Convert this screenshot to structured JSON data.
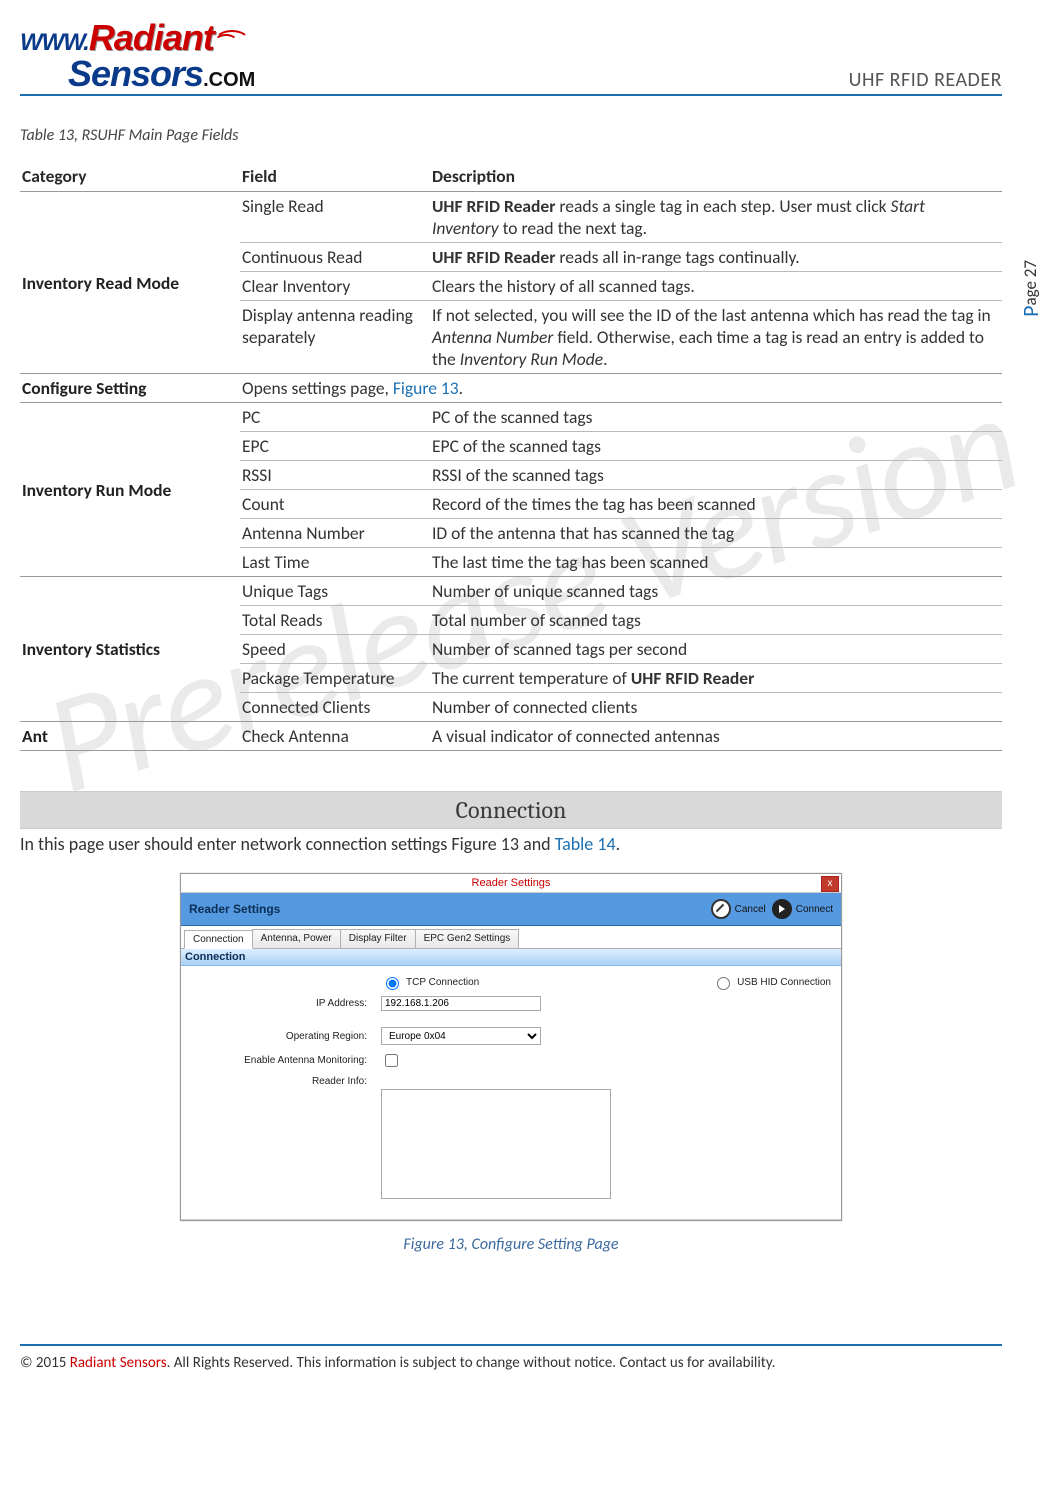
{
  "header": {
    "logo_www": "WWW.",
    "logo_radiant": "Radiant",
    "logo_sensors": "Sensors",
    "logo_com": ".COM",
    "doc_title": "UHF RFID READER"
  },
  "page_number": {
    "prefix": "P",
    "rest": "age 27"
  },
  "table_caption": "Table 13, RSUHF Main Page Fields",
  "columns": {
    "category": "Category",
    "field": "Field",
    "description": "Description"
  },
  "categories": [
    {
      "name": "Inventory Read Mode",
      "rows": [
        {
          "field": "Single Read",
          "descParts": [
            {
              "text": "UHF RFID Reader",
              "style": "bold"
            },
            {
              "text": " reads a single tag in each step. User must click "
            },
            {
              "text": "Start Inventory",
              "style": "italic"
            },
            {
              "text": " to read the next tag."
            }
          ]
        },
        {
          "field": "Continuous Read",
          "descParts": [
            {
              "text": "UHF RFID Reader",
              "style": "bold"
            },
            {
              "text": " reads all in-range tags continually."
            }
          ]
        },
        {
          "field": "Clear Inventory",
          "desc": "Clears the history of all scanned tags."
        },
        {
          "field": "Display antenna reading separately",
          "descParts": [
            {
              "text": "If not selected, you will see the ID of the last antenna which has read the tag in "
            },
            {
              "text": "Antenna Number",
              "style": "italic"
            },
            {
              "text": " field. Otherwise, each time a tag is read an entry is added to the "
            },
            {
              "text": "Inventory Run Mode",
              "style": "italic"
            },
            {
              "text": "."
            }
          ]
        }
      ]
    },
    {
      "name": "Configure Setting",
      "rows": [
        {
          "field": "",
          "descParts": [
            {
              "text": "Opens settings page, "
            },
            {
              "text": "Figure 13",
              "style": "link"
            },
            {
              "text": "."
            }
          ],
          "spanFieldAndDesc": true
        }
      ]
    },
    {
      "name": "Inventory Run Mode",
      "rows": [
        {
          "field": "PC",
          "desc": "PC of the scanned tags"
        },
        {
          "field": "EPC",
          "desc": "EPC of the scanned tags"
        },
        {
          "field": "RSSI",
          "desc": "RSSI of the scanned tags"
        },
        {
          "field": "Count",
          "desc": "Record of the times the tag has been scanned"
        },
        {
          "field": "Antenna Number",
          "desc": "ID of the antenna that has scanned the tag"
        },
        {
          "field": "Last Time",
          "desc": "The last time the tag has been scanned"
        }
      ]
    },
    {
      "name": "Inventory Statistics",
      "rows": [
        {
          "field": "Unique Tags",
          "desc": "Number of unique scanned tags"
        },
        {
          "field": "Total Reads",
          "desc": "Total number of scanned tags"
        },
        {
          "field": "Speed",
          "desc": "Number of scanned tags per second"
        },
        {
          "field": "Package Temperature",
          "descParts": [
            {
              "text": "The current temperature of "
            },
            {
              "text": "UHF RFID Reader",
              "style": "bold"
            }
          ]
        },
        {
          "field": "Connected Clients",
          "desc": "Number of connected clients"
        }
      ]
    },
    {
      "name": "Ant",
      "rows": [
        {
          "field": "Check Antenna",
          "desc": "A visual indicator of connected antennas"
        }
      ]
    }
  ],
  "section": {
    "heading": "Connection",
    "intro_pre": "In this page user should enter network connection settings Figure 13 and ",
    "intro_link": "Table 14",
    "intro_post": "."
  },
  "dialog": {
    "window_title": "Reader Settings",
    "close": "x",
    "ribbon_title": "Reader Settings",
    "cancel": "Cancel",
    "connect": "Connect",
    "tabs": [
      "Connection",
      "Antenna, Power",
      "Display Filter",
      "EPC Gen2 Settings"
    ],
    "group": "Connection",
    "tcp_radio": "TCP Connection",
    "usb_radio": "USB HID Connection",
    "ip_label": "IP Address:",
    "ip_value": "192.168.1.206",
    "region_label": "Operating Region:",
    "region_value": "Europe 0x04",
    "antmon_label": "Enable Antenna Monitoring:",
    "readerinfo_label": "Reader Info:"
  },
  "figure_caption": "Figure 13, Configure Setting Page",
  "footer": {
    "copyright_pre": "© 2015 ",
    "brand": "Radiant Sensors",
    "copyright_post": ". All Rights Reserved. This information is subject to change without notice. Contact us for availability."
  },
  "watermark": "Prerelease Version"
}
